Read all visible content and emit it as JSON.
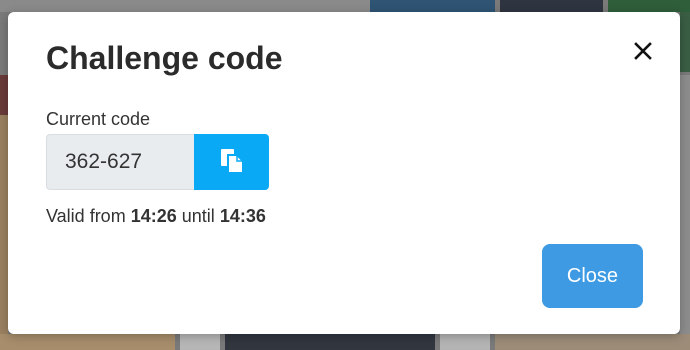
{
  "modal": {
    "title": "Challenge code",
    "close_icon": "close-icon",
    "field_label": "Current code",
    "code_value": "362-627",
    "copy_icon": "copy-icon",
    "validity": {
      "prefix": "Valid from",
      "from_time": "14:26",
      "middle": "until",
      "until_time": "14:36"
    },
    "close_button_label": "Close"
  },
  "colors": {
    "copy_button_bg": "#0aa9f5",
    "close_button_bg": "#3d9ae3",
    "input_bg": "#e9ecef",
    "title_text": "#2b2b2b"
  }
}
